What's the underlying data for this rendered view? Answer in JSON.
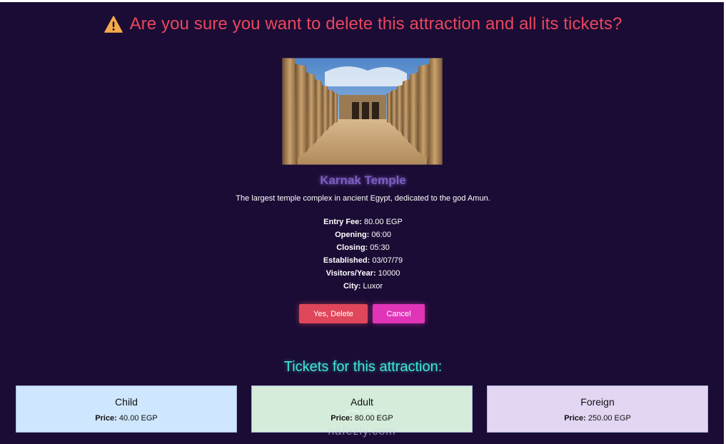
{
  "dialog": {
    "warning_icon": "warning-triangle-icon",
    "question": "Are you sure you want to delete this attraction and all its tickets?",
    "accent_color": "#e8475d"
  },
  "attraction": {
    "name": "Karnak Temple",
    "description": "The largest temple complex in ancient Egypt, dedicated to the god Amun.",
    "details": [
      {
        "label": "Entry Fee:",
        "value": "80.00 EGP"
      },
      {
        "label": "Opening:",
        "value": "06:00"
      },
      {
        "label": "Closing:",
        "value": "05:30"
      },
      {
        "label": "Established:",
        "value": "03/07/79"
      },
      {
        "label": "Visitors/Year:",
        "value": "10000"
      },
      {
        "label": "City:",
        "value": "Luxor"
      }
    ]
  },
  "actions": {
    "delete_label": "Yes, Delete",
    "cancel_label": "Cancel"
  },
  "tickets": {
    "heading": "Tickets for this attraction:",
    "items": [
      {
        "name": "Child",
        "price_label": "Price:",
        "price": "40.00 EGP"
      },
      {
        "name": "Adult",
        "price_label": "Price:",
        "price": "80.00 EGP"
      },
      {
        "name": "Foreign",
        "price_label": "Price:",
        "price": "250.00 EGP"
      }
    ]
  },
  "watermark": {
    "text": "nafezly.com"
  }
}
